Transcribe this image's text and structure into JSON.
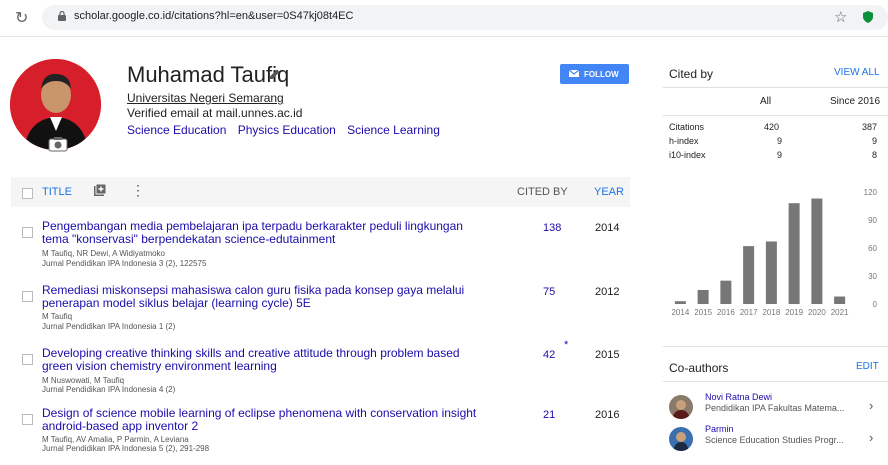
{
  "browser": {
    "url": "scholar.google.co.id/citations?hl=en&user=0S47kj08t4EC"
  },
  "profile": {
    "name": "Muhamad Taufiq",
    "affiliation": "Universitas Negeri Semarang",
    "email": "Verified email at mail.unnes.ac.id",
    "interests": [
      "Science Education",
      "Physics Education",
      "Science Learning"
    ],
    "follow_label": "FOLLOW"
  },
  "table": {
    "col_title": "TITLE",
    "col_cited": "CITED BY",
    "col_year": "YEAR",
    "rows": [
      {
        "title": "Pengembangan media pembelajaran ipa terpadu berkarakter peduli lingkungan tema \"konservasi\" berpendekatan science-edutainment",
        "authors": "M Taufiq, NR Dewi, A Widiyatmoko",
        "journal": "Jurnal Pendidikan IPA Indonesia 3 (2), 122575",
        "cited": "138",
        "year": "2014",
        "asterisk": ""
      },
      {
        "title": "Remediasi miskonsepsi mahasiswa calon guru fisika pada konsep gaya melalui penerapan model siklus belajar (learning cycle) 5E",
        "authors": "M Taufiq",
        "journal": "Jurnal Pendidikan IPA Indonesia 1 (2)",
        "cited": "75",
        "year": "2012",
        "asterisk": ""
      },
      {
        "title": "Developing creative thinking skills and creative attitude through problem based green vision chemistry environment learning",
        "authors": "M Nuswowati, M Taufiq",
        "journal": "Jurnal Pendidikan IPA Indonesia 4 (2)",
        "cited": "42",
        "year": "2015",
        "asterisk": "*"
      },
      {
        "title": "Design of science mobile learning of eclipse phenomena with conservation insight android-based app inventor 2",
        "authors": "M Taufiq, AV Amalia, P Parmin, A Leviana",
        "journal": "Jurnal Pendidikan IPA Indonesia 5 (2), 291-298",
        "cited": "21",
        "year": "2016",
        "asterisk": ""
      }
    ]
  },
  "cited_by": {
    "title": "Cited by",
    "view_all": "VIEW ALL",
    "col_all": "All",
    "col_since": "Since 2016",
    "stats": [
      {
        "label": "Citations",
        "all": "420",
        "since": "387"
      },
      {
        "label": "h-index",
        "all": "9",
        "since": "9"
      },
      {
        "label": "i10-index",
        "all": "9",
        "since": "8"
      }
    ]
  },
  "chart_data": {
    "type": "bar",
    "categories": [
      "2014",
      "2015",
      "2016",
      "2017",
      "2018",
      "2019",
      "2020",
      "2021"
    ],
    "values": [
      3,
      15,
      25,
      62,
      67,
      108,
      113,
      8
    ],
    "ylim": [
      0,
      120
    ],
    "yticks": [
      "120",
      "90",
      "60",
      "30",
      "0"
    ],
    "bar_color": "#777777",
    "grid": false
  },
  "coauthors": {
    "title": "Co-authors",
    "edit": "EDIT",
    "items": [
      {
        "name": "Novi Ratna Dewi",
        "affiliation": "Pendidikan IPA Fakultas Matema..."
      },
      {
        "name": "Parmin",
        "affiliation": "Science Education Studies Progr..."
      }
    ]
  }
}
